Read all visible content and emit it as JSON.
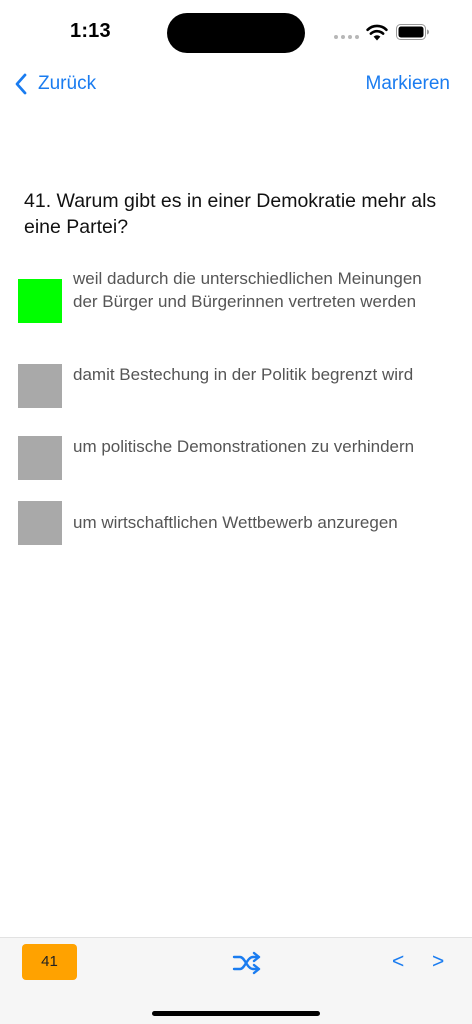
{
  "status_bar": {
    "time": "1:13"
  },
  "nav": {
    "back_label": "Zurück",
    "mark_label": "Markieren"
  },
  "question": {
    "text": "41. Warum gibt es in einer Demokratie mehr als eine Partei?"
  },
  "answers": [
    {
      "text": "weil dadurch die unterschiedlichen Meinungen der Bürger und Bürgerinnen vertreten werden",
      "state": "correct"
    },
    {
      "text": "damit Bestechung in der Politik begrenzt wird",
      "state": "neutral"
    },
    {
      "text": "um politische Demonstrationen zu verhindern",
      "state": "neutral"
    },
    {
      "text": "um wirtschaftlichen Wettbewerb anzuregen",
      "state": "neutral"
    }
  ],
  "toolbar": {
    "counter": "41",
    "prev_label": "<",
    "next_label": ">",
    "shuffle_icon": "shuffle-icon"
  },
  "colors": {
    "accent": "#1a7cf0",
    "correct": "#00ff00",
    "neutral": "#a9a9a9",
    "counter_bg": "#ffa200"
  }
}
